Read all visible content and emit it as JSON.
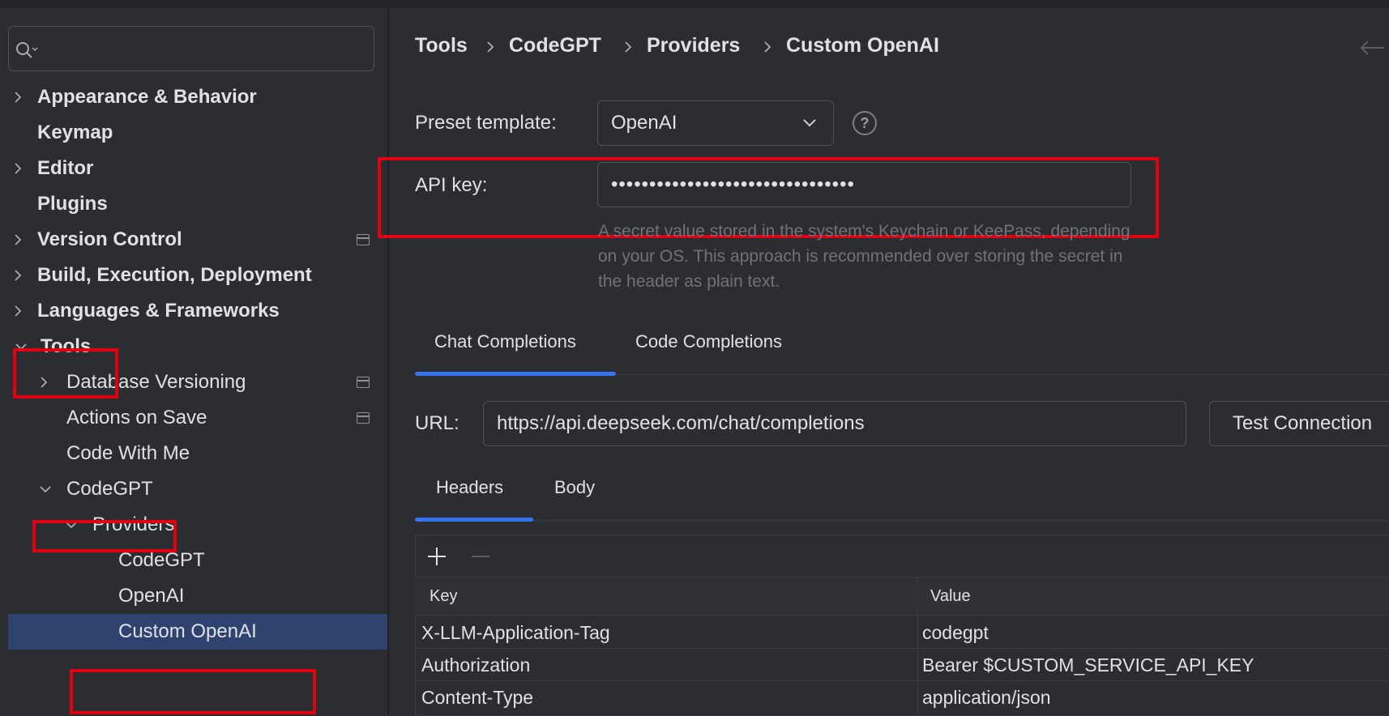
{
  "search": {
    "placeholder": ""
  },
  "sidebar": {
    "items": [
      {
        "label": "Appearance & Behavior"
      },
      {
        "label": "Keymap"
      },
      {
        "label": "Editor"
      },
      {
        "label": "Plugins"
      },
      {
        "label": "Version Control"
      },
      {
        "label": "Build, Execution, Deployment"
      },
      {
        "label": "Languages & Frameworks"
      },
      {
        "label": "Tools"
      },
      {
        "label": "Database Versioning"
      },
      {
        "label": "Actions on Save"
      },
      {
        "label": "Code With Me"
      },
      {
        "label": "CodeGPT"
      },
      {
        "label": "Providers"
      },
      {
        "label": "CodeGPT"
      },
      {
        "label": "OpenAI"
      },
      {
        "label": "Custom OpenAI"
      }
    ]
  },
  "breadcrumb": [
    "Tools",
    "CodeGPT",
    "Providers",
    "Custom OpenAI"
  ],
  "form": {
    "preset_label": "Preset template:",
    "preset_value": "OpenAI",
    "help_glyph": "?",
    "api_key_label": "API key:",
    "api_key_value": "••••••••••••••••••••••••••••••••",
    "hint_lines": [
      "A secret value stored in the system's Keychain or KeePass, depending",
      "on your OS. This approach is recommended over storing the secret in",
      "the header as plain text."
    ],
    "url_label": "URL:",
    "url_value": "https://api.deepseek.com/chat/completions",
    "test_button": "Test Connection"
  },
  "tabs": [
    "Chat Completions",
    "Code Completions"
  ],
  "subtabs": [
    "Headers",
    "Body"
  ],
  "table": {
    "columns": [
      "Key",
      "Value"
    ],
    "rows": [
      [
        "X-LLM-Application-Tag",
        "codegpt"
      ],
      [
        "Authorization",
        "Bearer $CUSTOM_SERVICE_API_KEY"
      ],
      [
        "Content-Type",
        "application/json"
      ]
    ]
  },
  "colors": {
    "accent": "#3574f0",
    "selection": "#2e436e",
    "highlight": "#e0000f"
  }
}
